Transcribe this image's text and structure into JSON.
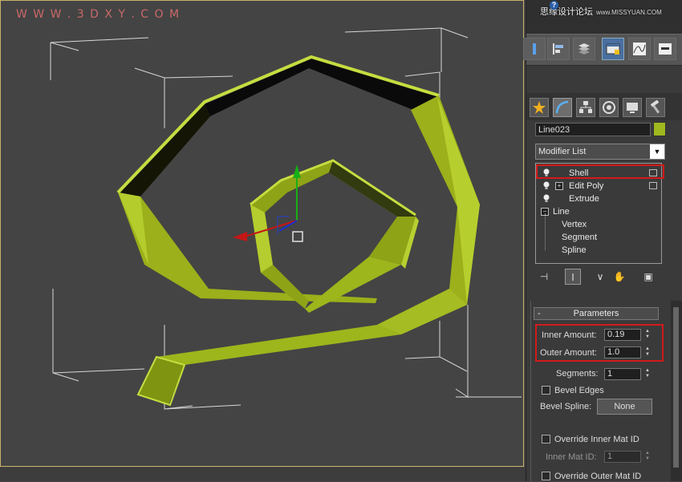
{
  "watermark": "W W W . 3 D X Y . C O M",
  "top_watermark": {
    "text": "思缘设计论坛",
    "url": "www.MISSYUAN.COM"
  },
  "help_icon": "?",
  "object_name": "Line023",
  "object_color": "#9fb91f",
  "modifier_list_label": "Modifier List",
  "stack": {
    "items": [
      {
        "label": "Shell",
        "selected": true
      },
      {
        "label": "Edit Poly",
        "expandable": true
      },
      {
        "label": "Extrude"
      },
      {
        "label": "Line",
        "expandable": true
      }
    ],
    "line_sub": [
      "Vertex",
      "Segment",
      "Spline"
    ]
  },
  "parameters": {
    "header": "Parameters",
    "collapse_symbol": "-",
    "inner_amount_label": "Inner Amount:",
    "inner_amount_value": "0.19",
    "outer_amount_label": "Outer Amount:",
    "outer_amount_value": "1.0",
    "segments_label": "Segments:",
    "segments_value": "1",
    "bevel_edges_label": "Bevel Edges",
    "bevel_spline_label": "Bevel Spline:",
    "bevel_spline_value": "None",
    "override_inner_label": "Override Inner Mat ID",
    "inner_mat_id_label": "Inner Mat ID:",
    "inner_mat_id_value": "1",
    "override_outer_label": "Override Outer Mat ID"
  },
  "colors": {
    "highlight": "#d21a1a",
    "shape": "#9fb91f"
  }
}
